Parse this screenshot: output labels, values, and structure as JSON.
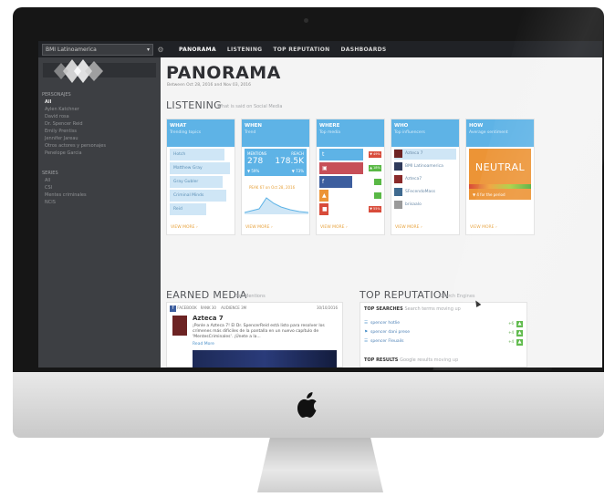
{
  "topbar": {
    "account": "BMI Latinoamerica",
    "nav": [
      "PANORAMA",
      "LISTENING",
      "TOP REPUTATION",
      "DASHBOARDS"
    ]
  },
  "sidebar": {
    "section1": "PERSONAJES",
    "items1": [
      "All",
      "Aylen Katchner",
      "David rosa",
      "Dr. Spencer Reid",
      "Emily Prentiss",
      "Jennifer Jareau",
      "Otros actores y personajes",
      "Penelope Garcia"
    ],
    "section2": "SERIES",
    "items2": [
      "All",
      "CSI",
      "Mentes criminales",
      "NCIS"
    ]
  },
  "page": {
    "title": "PANORAMA",
    "daterange": "Between Oct 28, 2016 and Nov 03, 2016"
  },
  "listening": {
    "title": "LISTENING",
    "subtitle": "What is said on Social Media",
    "view_more": "VIEW MORE ›",
    "what": {
      "title": "WHAT",
      "subtitle": "Trending topics",
      "topics": [
        "Hotch",
        "Matthew Gray",
        "Gray Gubler",
        "Criminal Minds",
        "Reid"
      ]
    },
    "when": {
      "title": "WHEN",
      "subtitle": "Trend",
      "mentions_label": "MENTIONS",
      "reach_label": "REACH",
      "mentions": "278",
      "reach": "178.5K",
      "mentions_change": "▼ 59%",
      "reach_change": "▼ 73%",
      "peak": "PEAK 67 on Oct 28, 2016"
    },
    "where": {
      "title": "WHERE",
      "subtitle": "Top media",
      "rows": [
        {
          "icon": "ᴛ",
          "color": "#5eb3e6",
          "pct": "▼ 49%",
          "pct_color": "#d84b3a"
        },
        {
          "icon": "▣",
          "color": "#c74f58",
          "pct": "▲ 18%",
          "pct_color": "#59b845"
        },
        {
          "icon": "f",
          "color": "#3d5e9e",
          "pct": "",
          "pct_color": "#59b845"
        },
        {
          "icon": "▲",
          "color": "#ec9436",
          "pct": "",
          "pct_color": "#59b845"
        },
        {
          "icon": "■",
          "color": "#d84b3a",
          "pct": "▼ 55%",
          "pct_color": "#d84b3a"
        }
      ]
    },
    "who": {
      "title": "WHO",
      "subtitle": "Top influencers",
      "people": [
        "Azteca 7",
        "BMI Latinoamerica",
        "Azteca7",
        "SFecendoMass",
        "brisaalo"
      ]
    },
    "how": {
      "title": "HOW",
      "subtitle": "Average sentiment",
      "sentiment": "NEUTRAL",
      "period": "▼ 4 for the period"
    }
  },
  "earned_media": {
    "title": "EARNED MEDIA",
    "subtitle": "Top Mentions",
    "source": "FACEBOOK",
    "rank": "RANK 30",
    "audience": "AUDIENCE 3M",
    "date": "30/10/2016",
    "author": "Azteca 7",
    "text": "¡Ponle a Azteca 7! El Dr. SpencerReid está listo para resolver los crímenes más difíciles de la pantalla en un nuevo capítulo de 'MentesCriminales'. ¡Únete a la...",
    "read_more": "Read More"
  },
  "top_reputation": {
    "title": "TOP REPUTATION",
    "subtitle": "Search Engines",
    "searches_title": "TOP SEARCHES",
    "searches_sub": "Search terms moving up",
    "searches": [
      {
        "term": "spencer hotlie",
        "val": "+6",
        "box": "▲"
      },
      {
        "term": "spencer dani prese",
        "val": "+4",
        "box": "▲"
      },
      {
        "term": "spencer Fleuails",
        "val": "+4",
        "box": "▲"
      }
    ],
    "results_title": "TOP RESULTS",
    "results_sub": "Google results moving up"
  },
  "colors": {
    "accent": "#5eb3e6",
    "orange": "#ec9436",
    "sidebar": "#3d3f43",
    "topbar": "#202226"
  }
}
